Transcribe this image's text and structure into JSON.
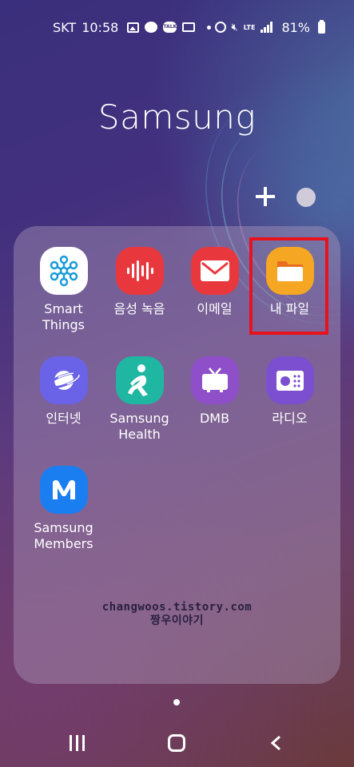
{
  "status_bar": {
    "carrier": "SKT",
    "time": "10:58",
    "network": "LTE",
    "battery": "81%"
  },
  "folder": {
    "title": "Samsung"
  },
  "apps": [
    {
      "label": "Smart\nThings",
      "icon": "smartthings-icon"
    },
    {
      "label": "음성 녹음",
      "icon": "voice-recorder-icon"
    },
    {
      "label": "이메일",
      "icon": "email-icon"
    },
    {
      "label": "내 파일",
      "icon": "folder-icon"
    },
    {
      "label": "인터넷",
      "icon": "internet-icon"
    },
    {
      "label": "Samsung\nHealth",
      "icon": "health-icon"
    },
    {
      "label": "DMB",
      "icon": "tv-icon"
    },
    {
      "label": "라디오",
      "icon": "radio-icon"
    },
    {
      "label": "Samsung\nMembers",
      "icon": "members-icon"
    }
  ],
  "watermark": {
    "line1": "changwoos.tistory.com",
    "line2": "짱우이야기"
  },
  "colors": {
    "highlight": "#e8121c",
    "accent_red": "#e8383d",
    "accent_orange": "#f5a623"
  }
}
